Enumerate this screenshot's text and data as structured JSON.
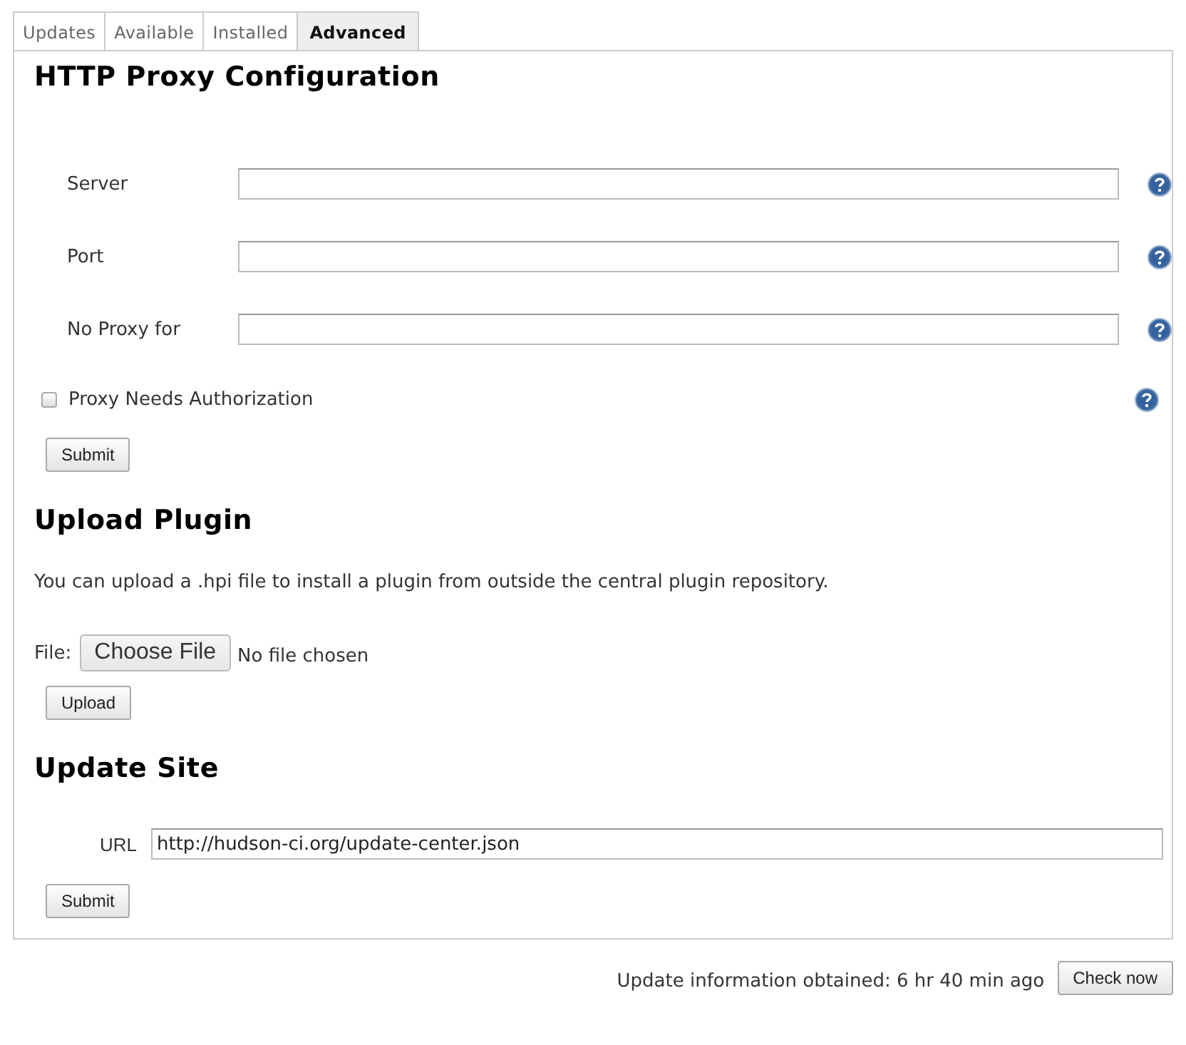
{
  "tabs": [
    {
      "label": "Updates",
      "selected": false
    },
    {
      "label": "Available",
      "selected": false
    },
    {
      "label": "Installed",
      "selected": false
    },
    {
      "label": "Advanced",
      "selected": true
    }
  ],
  "sections": [
    {
      "title": "HTTP Proxy Configuration",
      "rows": [
        {
          "kind": "field",
          "label": "Server",
          "help": true
        },
        {
          "kind": "field",
          "label": "Port",
          "help": true
        },
        {
          "kind": "field",
          "label": "No Proxy for",
          "help": true
        },
        {
          "kind": "checkbox",
          "label": "Proxy Needs Authorization",
          "checked": false,
          "help": true
        },
        {
          "kind": "button",
          "label": "Submit"
        }
      ]
    },
    {
      "title": "Upload Plugin",
      "rows": [
        {
          "kind": "text",
          "text": "You can upload a .hpi file to install a plugin from outside the central plugin repository."
        },
        {
          "kind": "file",
          "label": "File:",
          "button": "Choose File",
          "status": "No file chosen"
        },
        {
          "kind": "button",
          "label": "Upload"
        }
      ]
    },
    {
      "title": "Update Site",
      "rows": [
        {
          "kind": "url",
          "label": "URL",
          "value": "http://hudson-ci.org/update-center.json"
        },
        {
          "kind": "button",
          "label": "Submit"
        }
      ]
    }
  ],
  "footer": {
    "info": "Update information obtained: 6 hr 40 min ago",
    "button": "Check now"
  }
}
